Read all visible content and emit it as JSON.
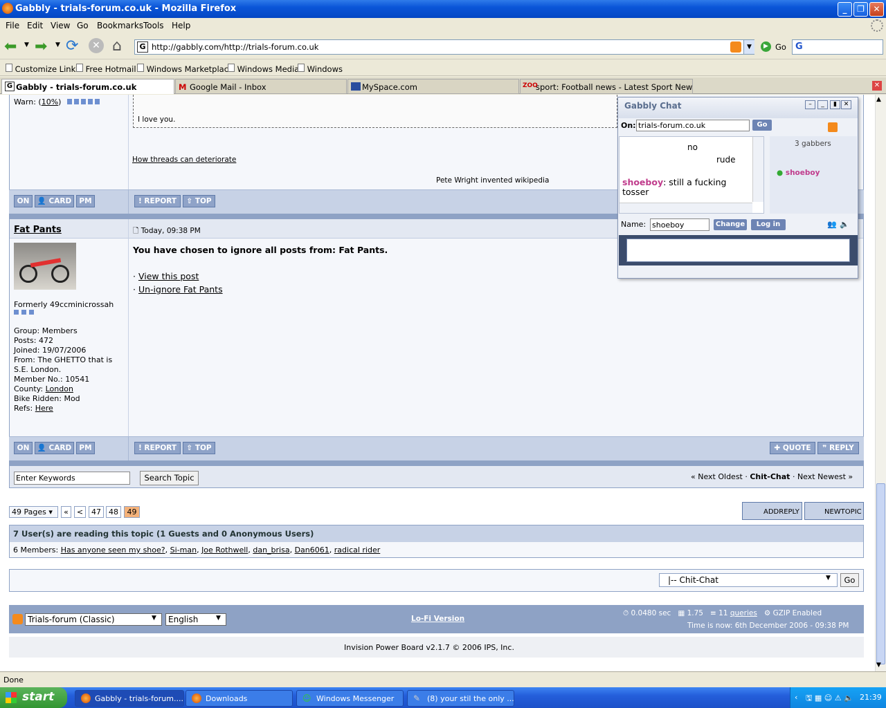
{
  "window": {
    "title": "Gabbly - trials-forum.co.uk - Mozilla Firefox"
  },
  "menu": [
    "File",
    "Edit",
    "View",
    "Go",
    "Bookmarks",
    "Tools",
    "Help"
  ],
  "nav": {
    "url": "http://gabbly.com/http://trials-forum.co.uk",
    "go_label": "Go"
  },
  "bookmarks": [
    "Customize Links",
    "Free Hotmail",
    "Windows Marketplace",
    "Windows Media",
    "Windows"
  ],
  "tabs": [
    "Gabbly - trials-forum.co.uk",
    "Google Mail - Inbox",
    "MySpace.com",
    "sport: Football news - Latest Sport News - ..."
  ],
  "post1": {
    "warn_label": "Warn: (",
    "warn_pct": "10%",
    "warn_close": ")",
    "quote_text": "I love you.",
    "link": "How threads can deteriorate",
    "signature": "Pete Wright invented wikipedia"
  },
  "buttons": {
    "on": "ON",
    "card": "CARD",
    "pm": "PM",
    "report": "REPORT",
    "top": "TOP",
    "quote": "QUOTE",
    "reply": "REPLY"
  },
  "post2": {
    "author": "Fat Pants",
    "date": "Today, 09:38 PM",
    "ignore_msg": "You have chosen to ignore all posts from: Fat Pants.",
    "view_link": "View this post",
    "unignore_link": "Un-ignore Fat Pants",
    "title": "Formerly 49ccminicrossah",
    "group": "Group: Members",
    "posts": "Posts: 472",
    "joined": "Joined: 19/07/2006",
    "from1": "From: The GHETTO that is",
    "from2": "S.E. London.",
    "member_no": "Member No.: 10541",
    "county_label": "County: ",
    "county": "London",
    "bike": "Bike Ridden: Mod",
    "refs_label": "Refs: ",
    "refs": "Here"
  },
  "search": {
    "placeholder": "Enter Keywords",
    "button": "Search Topic"
  },
  "topicnav": {
    "prev": "« Next Oldest",
    "current": "Chit-Chat",
    "next": "Next Newest »",
    "sep": "·"
  },
  "pagination": {
    "pages": "49 Pages",
    "first": "«",
    "prev": "<",
    "p47": "47",
    "p48": "48",
    "p49": "49",
    "addreply": "ADDREPLY",
    "newtopic": "NEWTOPIC"
  },
  "readers": {
    "header": "7 User(s) are reading this topic (1 Guests and 0 Anonymous Users)",
    "members_label": "6 Members:",
    "members": [
      "Has anyone seen my shoe?",
      "Si-man",
      "Joe Rothwell",
      "dan_brisa",
      "Dan6061",
      "radical rider"
    ]
  },
  "jump": {
    "selected": "|-- Chit-Chat",
    "go": "Go"
  },
  "footer": {
    "skin": "Trials-forum (Classic)",
    "lang": "English",
    "lofi": "Lo-Fi Version",
    "time": "0.0480 sec",
    "load": "1.75",
    "queries_num": "11",
    "queries": "queries",
    "gzip": "GZIP Enabled",
    "now": "Time is now: 6th December 2006 - 09:38 PM",
    "copyright": "Invision Power Board v2.1.7 © 2006  IPS, Inc."
  },
  "chat": {
    "title": "Gabbly Chat",
    "on_label": "On:",
    "on_value": "trials-forum.co.uk",
    "go": "Go",
    "gabbers": "3 gabbers",
    "users": [
      "shoeboy"
    ],
    "msg_partial1": "no",
    "msg_partial2": "rude",
    "msg_user": "shoeboy",
    "msg_text": ": still a fucking tosser",
    "name_label": "Name:",
    "name_value": "shoeboy",
    "change": "Change",
    "login": "Log in"
  },
  "status": "Done",
  "taskbar": {
    "start": "start",
    "items": [
      "Gabbly - trials-forum....",
      "Downloads",
      "Windows Messenger",
      "(8) your stil the only ..."
    ],
    "clock": "21:39"
  },
  "colors": {
    "accent": "#8fa3c8",
    "title": "#0a55d8",
    "current_page": "#f5b27a",
    "username_pink": "#c03c8c"
  }
}
